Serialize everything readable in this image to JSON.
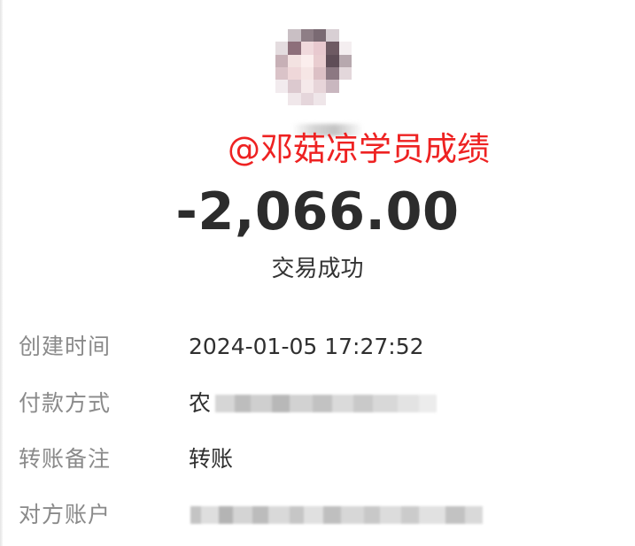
{
  "avatar": {
    "icon": "user-avatar-icon"
  },
  "watermark": {
    "text": "@邓菇凉学员成绩",
    "color": "#ee2222"
  },
  "transaction": {
    "amount": "-2,066.00",
    "status": "交易成功"
  },
  "details": {
    "created_time": {
      "label": "创建时间",
      "value": "2024-01-05 17:27:52"
    },
    "payment_method": {
      "label": "付款方式",
      "value": "农"
    },
    "remark": {
      "label": "转账备注",
      "value": "转账"
    },
    "counterparty": {
      "label": "对方账户"
    }
  }
}
